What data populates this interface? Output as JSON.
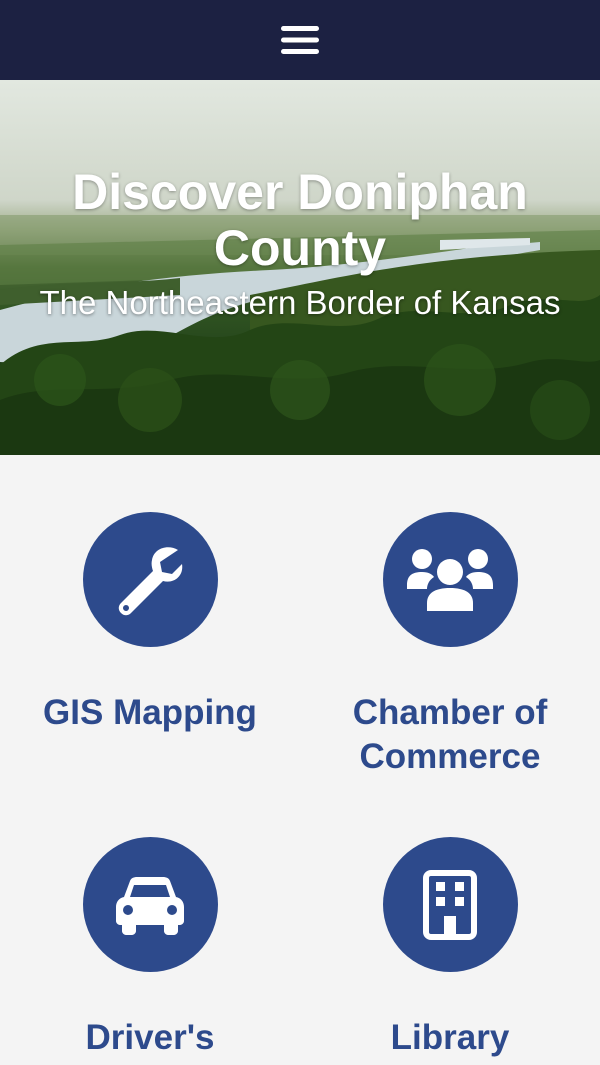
{
  "header": {
    "menu_icon": "hamburger-menu-icon",
    "background": "#1c2142"
  },
  "hero": {
    "title": "Discover Doniphan County",
    "subtitle": "The Northeastern Border of Kansas"
  },
  "tiles": [
    {
      "label": "GIS Mapping",
      "icon": "wrench-icon"
    },
    {
      "label": "Chamber of Commerce",
      "icon": "users-group-icon"
    },
    {
      "label": "Driver's",
      "icon": "car-icon"
    },
    {
      "label": "Library",
      "icon": "building-icon"
    }
  ],
  "colors": {
    "accent": "#2d4a8c",
    "page_background": "#f4f4f4"
  }
}
